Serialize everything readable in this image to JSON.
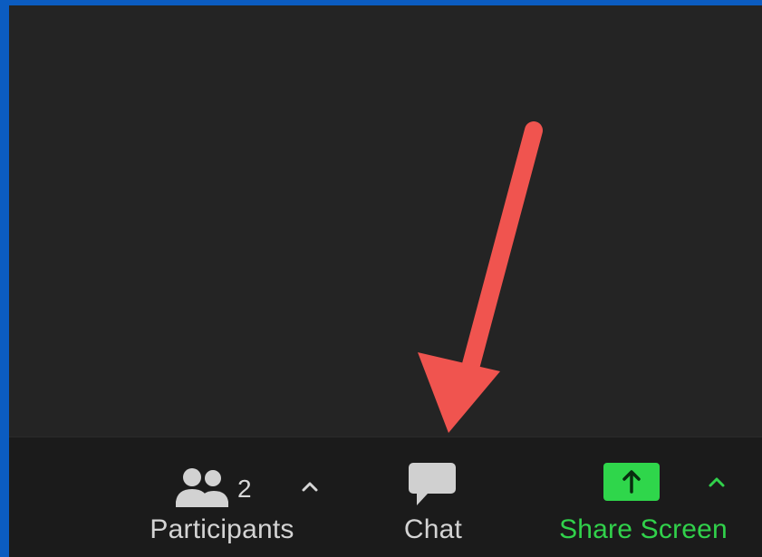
{
  "window": {
    "frame_color": "#0b5cc1",
    "background_color": "#242424",
    "toolbar_color": "#1b1b1b"
  },
  "toolbar": {
    "participants": {
      "label": "Participants",
      "count": "2",
      "icon": "participants-icon",
      "caret_icon": "chevron-up-icon"
    },
    "chat": {
      "label": "Chat",
      "icon": "chat-bubble-icon"
    },
    "share_screen": {
      "label": "Share Screen",
      "icon": "share-screen-up-arrow-icon",
      "caret_icon": "chevron-up-icon",
      "accent_color": "#31d14b"
    }
  },
  "annotation": {
    "arrow_color": "#f0544f",
    "target": "Chat"
  }
}
